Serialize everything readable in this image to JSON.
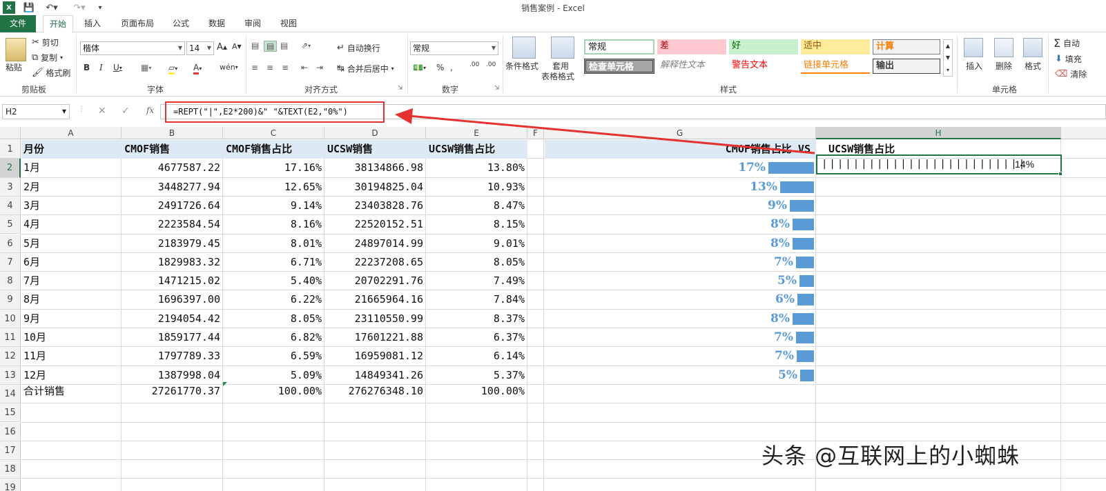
{
  "app": {
    "title": "销售案例 - Excel"
  },
  "quick_access": {
    "save_icon": "save-icon",
    "undo_icon": "undo-icon",
    "redo_icon": "redo-icon"
  },
  "tabs": [
    {
      "label": "文件"
    },
    {
      "label": "开始"
    },
    {
      "label": "插入"
    },
    {
      "label": "页面布局"
    },
    {
      "label": "公式"
    },
    {
      "label": "数据"
    },
    {
      "label": "审阅"
    },
    {
      "label": "视图"
    }
  ],
  "ribbon": {
    "clipboard": {
      "paste": "粘贴",
      "cut": "剪切",
      "copy": "复制",
      "format_painter": "格式刷",
      "label": "剪贴板"
    },
    "font": {
      "name": "楷体",
      "size": "14",
      "label": "字体"
    },
    "alignment": {
      "wrap": "自动换行",
      "merge": "合并后居中",
      "label": "对齐方式"
    },
    "number": {
      "format": "常规",
      "label": "数字"
    },
    "styles": {
      "conditional": "条件格式",
      "table_format_1": "套用",
      "table_format_2": "表格格式",
      "normal": "常规",
      "bad": "差",
      "good": "好",
      "neutral": "适中",
      "calc": "计算",
      "check": "检查单元格",
      "explain": "解释性文本",
      "warn": "警告文本",
      "link": "链接单元格",
      "output": "输出",
      "label": "样式"
    },
    "cells": {
      "insert": "插入",
      "delete": "删除",
      "format": "格式",
      "label": "单元格"
    },
    "editing": {
      "autosum": "自动",
      "fill": "填充",
      "clear": "清除"
    }
  },
  "formula_bar": {
    "name_box": "H2",
    "formula": "=REPT(\"|\",E2*200)&\"  \"&TEXT(E2,\"0%\")"
  },
  "sheet": {
    "columns": [
      "A",
      "B",
      "C",
      "D",
      "E",
      "F",
      "G",
      "H"
    ],
    "row_numbers": [
      "1",
      "2",
      "3",
      "4",
      "5",
      "6",
      "7",
      "8",
      "9",
      "10",
      "11",
      "12",
      "13",
      "14",
      "15",
      "16",
      "17",
      "18",
      "19"
    ],
    "headers": {
      "a": "月份",
      "b": "CMOF销售",
      "c": "CMOF销售占比",
      "d": "UCSW销售",
      "e": "UCSW销售占比",
      "g": "CMOF销售占比  VS",
      "h": "UCSW销售占比"
    },
    "rows": [
      {
        "month": "1月",
        "cmof": "4677587.22",
        "cmof_pct": "17.16%",
        "ucsw": "38134866.98",
        "ucsw_pct": "13.80%",
        "g_label": "17%",
        "g_value": 0.1716
      },
      {
        "month": "2月",
        "cmof": "3448277.94",
        "cmof_pct": "12.65%",
        "ucsw": "30194825.04",
        "ucsw_pct": "10.93%",
        "g_label": "13%",
        "g_value": 0.1265
      },
      {
        "month": "3月",
        "cmof": "2491726.64",
        "cmof_pct": "9.14%",
        "ucsw": "23403828.76",
        "ucsw_pct": "8.47%",
        "g_label": "9%",
        "g_value": 0.0914
      },
      {
        "month": "4月",
        "cmof": "2223584.54",
        "cmof_pct": "8.16%",
        "ucsw": "22520152.51",
        "ucsw_pct": "8.15%",
        "g_label": "8%",
        "g_value": 0.0816
      },
      {
        "month": "5月",
        "cmof": "2183979.45",
        "cmof_pct": "8.01%",
        "ucsw": "24897014.99",
        "ucsw_pct": "9.01%",
        "g_label": "8%",
        "g_value": 0.0801
      },
      {
        "month": "6月",
        "cmof": "1829983.32",
        "cmof_pct": "6.71%",
        "ucsw": "22237208.65",
        "ucsw_pct": "8.05%",
        "g_label": "7%",
        "g_value": 0.0671
      },
      {
        "month": "7月",
        "cmof": "1471215.02",
        "cmof_pct": "5.40%",
        "ucsw": "20702291.76",
        "ucsw_pct": "7.49%",
        "g_label": "5%",
        "g_value": 0.054
      },
      {
        "month": "8月",
        "cmof": "1696397.00",
        "cmof_pct": "6.22%",
        "ucsw": "21665964.16",
        "ucsw_pct": "7.84%",
        "g_label": "6%",
        "g_value": 0.0622
      },
      {
        "month": "9月",
        "cmof": "2194054.42",
        "cmof_pct": "8.05%",
        "ucsw": "23110550.99",
        "ucsw_pct": "8.37%",
        "g_label": "8%",
        "g_value": 0.0805
      },
      {
        "month": "10月",
        "cmof": "1859177.44",
        "cmof_pct": "6.82%",
        "ucsw": "17601221.88",
        "ucsw_pct": "6.37%",
        "g_label": "7%",
        "g_value": 0.0682
      },
      {
        "month": "11月",
        "cmof": "1797789.33",
        "cmof_pct": "6.59%",
        "ucsw": "16959081.12",
        "ucsw_pct": "6.14%",
        "g_label": "7%",
        "g_value": 0.0659
      },
      {
        "month": "12月",
        "cmof": "1387998.04",
        "cmof_pct": "5.09%",
        "ucsw": "14849341.26",
        "ucsw_pct": "5.37%",
        "g_label": "5%",
        "g_value": 0.0509
      }
    ],
    "total": {
      "label": "合计销售",
      "cmof": "27261770.37",
      "cmof_pct": "100.00%",
      "ucsw": "276276348.10",
      "ucsw_pct": "100.00%"
    },
    "h2": {
      "bars": "||||||||||||||||||||||||||||",
      "pct": "14%"
    }
  },
  "watermark": "头条 @互联网上的小蜘蛛",
  "colors": {
    "accent": "#217346",
    "bar": "#5b9bd5",
    "header_fill": "#dde9f5",
    "highlight": "#e5312f"
  }
}
